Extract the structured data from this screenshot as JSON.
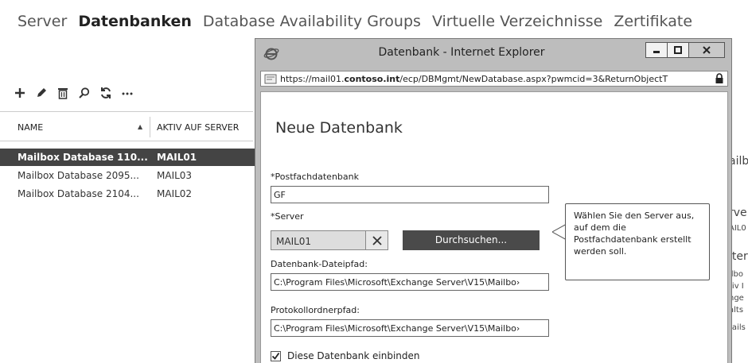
{
  "topnav": {
    "items": [
      "Server",
      "Datenbanken",
      "Database Availability Groups",
      "Virtuelle Verzeichnisse",
      "Zertifikate"
    ]
  },
  "table": {
    "col_name": "NAME",
    "col_server": "AKTIV AUF SERVER",
    "rows": [
      {
        "name": "Mailbox Database 110...",
        "server": "MAIL01"
      },
      {
        "name": "Mailbox Database 2095...",
        "server": "MAIL03"
      },
      {
        "name": "Mailbox Database 2104...",
        "server": "MAIL02"
      }
    ]
  },
  "side_fragments": [
    "ailb",
    "rve",
    "AIL0",
    "iter",
    "ilbo",
    "tiv I",
    "nge",
    "alts",
    "tails"
  ],
  "ie": {
    "title": "Datenbank - Internet Explorer",
    "url_prefix": "https://mail01.",
    "url_domain": "contoso.int",
    "url_suffix": "/ecp/DBMgmt/NewDatabase.aspx?pwmcid=3&ReturnObjectT"
  },
  "form": {
    "title": "Neue Datenbank",
    "mailbox_db_label": "*Postfachdatenbank",
    "mailbox_db_value": "GF",
    "server_label": "*Server",
    "server_value": "MAIL01",
    "browse_label": "Durchsuchen...",
    "db_path_label": "Datenbank-Dateipfad:",
    "db_path_value": "C:\\Program Files\\Microsoft\\Exchange Server\\V15\\Mailbo›",
    "log_path_label": "Protokollordnerpfad:",
    "log_path_value": "C:\\Program Files\\Microsoft\\Exchange Server\\V15\\Mailbo›",
    "mount_label": "Diese Datenbank einbinden",
    "tooltip": "Wählen Sie den Server aus, auf dem die Postfachdatenbank erstellt werden soll."
  }
}
